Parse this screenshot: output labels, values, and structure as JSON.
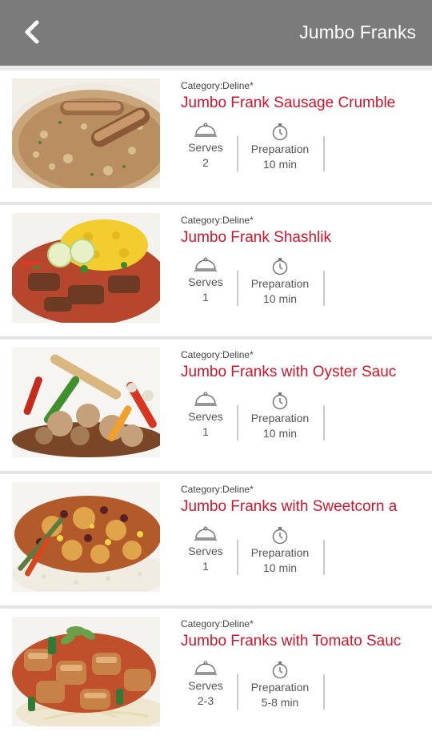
{
  "header": {
    "title": "Jumbo Franks",
    "back_icon": "chevron-left-icon"
  },
  "recipes": [
    {
      "category": "Category:Deline*",
      "name": "Jumbo Frank Sausage Crumble",
      "serves_label": "Serves",
      "serves": "2",
      "prep_label": "Preparation",
      "prep": "10 min"
    },
    {
      "category": "Category:Deline*",
      "name": "Jumbo Frank Shashlik",
      "serves_label": "Serves",
      "serves": "1",
      "prep_label": "Preparation",
      "prep": "10 min"
    },
    {
      "category": "Category:Deline*",
      "name": "Jumbo Franks with Oyster Sauc",
      "serves_label": "Serves",
      "serves": "1",
      "prep_label": "Preparation",
      "prep": "10 min"
    },
    {
      "category": "Category:Deline*",
      "name": "Jumbo Franks with Sweetcorn a",
      "serves_label": "Serves",
      "serves": "1",
      "prep_label": "Preparation",
      "prep": "10 min"
    },
    {
      "category": "Category:Deline*",
      "name": "Jumbo Franks with Tomato Sauc",
      "serves_label": "Serves",
      "serves": "2-3",
      "prep_label": "Preparation",
      "prep": "5-8 min"
    }
  ],
  "icons": {
    "serves": "cloche-icon",
    "prep": "stopwatch-icon"
  }
}
